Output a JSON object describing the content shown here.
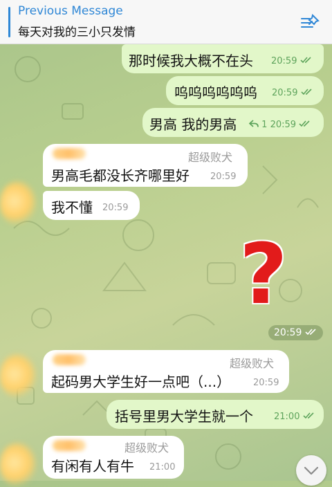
{
  "pinned": {
    "title": "Previous Message",
    "text": "每天对我的三小只发情"
  },
  "messages": [
    {
      "direction": "out",
      "text": "那时候我大概不在头",
      "time": "20:59"
    },
    {
      "direction": "out",
      "text": "呜呜呜呜呜呜",
      "time": "20:59"
    },
    {
      "direction": "out",
      "text": "男高 我的男高",
      "time": "20:59",
      "replies": "1"
    },
    {
      "direction": "in",
      "sender_tag": "超级败犬",
      "text": "男高毛都没长齐哪里好",
      "time": "20:59"
    },
    {
      "direction": "in",
      "text": "我不懂",
      "time": "20:59"
    },
    {
      "direction": "out",
      "type": "sticker",
      "sticker": "?",
      "time": "20:59"
    },
    {
      "direction": "in",
      "sender_tag": "超级败犬",
      "text": "起码男大学生好一点吧（...）",
      "time": "20:59"
    },
    {
      "direction": "out",
      "text": "括号里男大学生就一个",
      "time": "21:00"
    },
    {
      "direction": "in",
      "sender_tag": "超级败犬",
      "text": "有闲有人有牛",
      "time": "21:00"
    }
  ],
  "icons": {
    "pinned": "pin-list-icon",
    "read": "double-check-icon",
    "reply": "reply-arrow-icon",
    "scroll": "chevron-down-icon"
  },
  "colors": {
    "accent": "#2f87d6",
    "outgoing_bubble": "#e2f7c9",
    "incoming_bubble": "#ffffff",
    "outgoing_meta": "#5da35b",
    "sticker": "#e21b1b"
  }
}
